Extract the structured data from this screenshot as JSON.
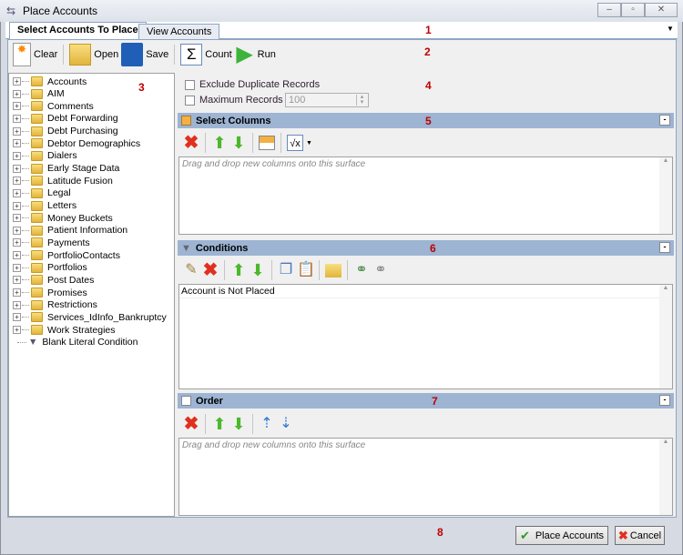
{
  "window": {
    "title": "Place Accounts",
    "controls": [
      "minimize",
      "maximize",
      "close"
    ]
  },
  "tabs": [
    {
      "label": "Select Accounts To Place",
      "active": true
    },
    {
      "label": "View Accounts",
      "active": false
    }
  ],
  "toolbar": {
    "clear": "Clear",
    "open": "Open",
    "save": "Save",
    "count": "Count",
    "run": "Run"
  },
  "callouts": [
    "1",
    "2",
    "3",
    "4",
    "5",
    "6",
    "7",
    "8"
  ],
  "tree": {
    "items": [
      "Accounts",
      "AIM",
      "Comments",
      "Debt Forwarding",
      "Debt Purchasing",
      "Debtor Demographics",
      "Dialers",
      "Early Stage Data",
      "Latitude Fusion",
      "Legal",
      "Letters",
      "Money Buckets",
      "Patient Information",
      "Payments",
      "PortfolioContacts",
      "Portfolios",
      "Post Dates",
      "Promises",
      "Restrictions",
      "Services_IdInfo_Bankruptcy",
      "Work Strategies"
    ],
    "leaf": "Blank Literal Condition"
  },
  "options": {
    "exclude_duplicates": {
      "label": "Exclude Duplicate Records",
      "checked": false
    },
    "max_records": {
      "label": "Maximum Records",
      "checked": false,
      "value": "100"
    }
  },
  "select_columns": {
    "title": "Select Columns",
    "hint": "Drag and drop new columns onto this surface"
  },
  "conditions": {
    "title": "Conditions",
    "items": [
      "Account is Not Placed"
    ]
  },
  "order": {
    "title": "Order",
    "hint": "Drag and drop new columns onto this surface"
  },
  "footer": {
    "place_accounts": "Place Accounts",
    "cancel": "Cancel"
  },
  "colors": {
    "section_header": "#9db4d3",
    "callout": "#c00000"
  }
}
